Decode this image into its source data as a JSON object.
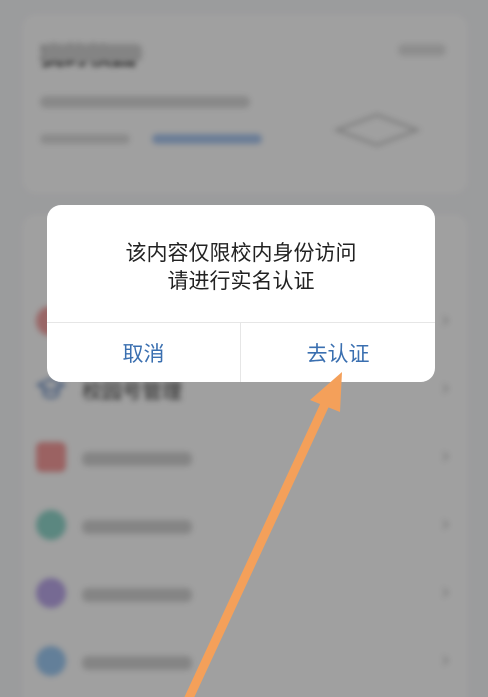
{
  "background": {
    "top_card": {
      "title": "我的校园",
      "action": "",
      "line1": "",
      "line2": "",
      "link": ""
    },
    "menu": {
      "head": "",
      "items": [
        {
          "label": "",
          "icon": "red-circle-icon",
          "color": "#f0a0a0"
        },
        {
          "label": "校园号管理",
          "icon": "graduation-cap-icon",
          "color": "#5a7fb8"
        },
        {
          "label": "",
          "icon": "red-card-icon",
          "color": "#f29a9a"
        },
        {
          "label": "",
          "icon": "teal-circle-icon",
          "color": "#8fd3c8"
        },
        {
          "label": "",
          "icon": "purple-circle-icon",
          "color": "#b9a6e6"
        },
        {
          "label": "",
          "icon": "blue-circle-icon",
          "color": "#9cc7ef"
        }
      ]
    }
  },
  "dialog": {
    "message_line1": "该内容仅限校内身份访问",
    "message_line2": "请进行实名认证",
    "cancel_label": "取消",
    "confirm_label": "去认证",
    "button_color": "#3a6fb0"
  },
  "annotation": {
    "arrow_color": "#f4a05a"
  }
}
